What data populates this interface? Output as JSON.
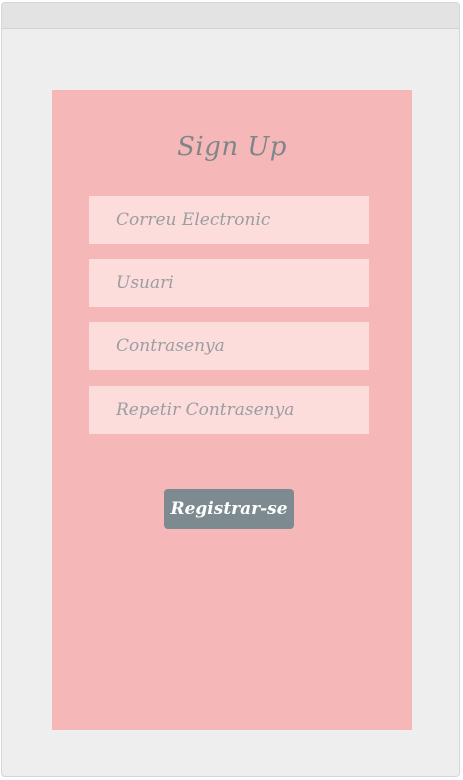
{
  "form": {
    "title": "Sign Up",
    "fields": [
      {
        "placeholder": "Correu Electronic",
        "value": ""
      },
      {
        "placeholder": "Usuari",
        "value": ""
      },
      {
        "placeholder": "Contrasenya",
        "value": ""
      },
      {
        "placeholder": "Repetir Contrasenya",
        "value": ""
      }
    ],
    "submit_label": "Registrar-se"
  },
  "colors": {
    "card_background": "#f5b7b7",
    "field_background": "#fddcdc",
    "button_background": "#7d8b90",
    "title_color": "#7d878b"
  }
}
